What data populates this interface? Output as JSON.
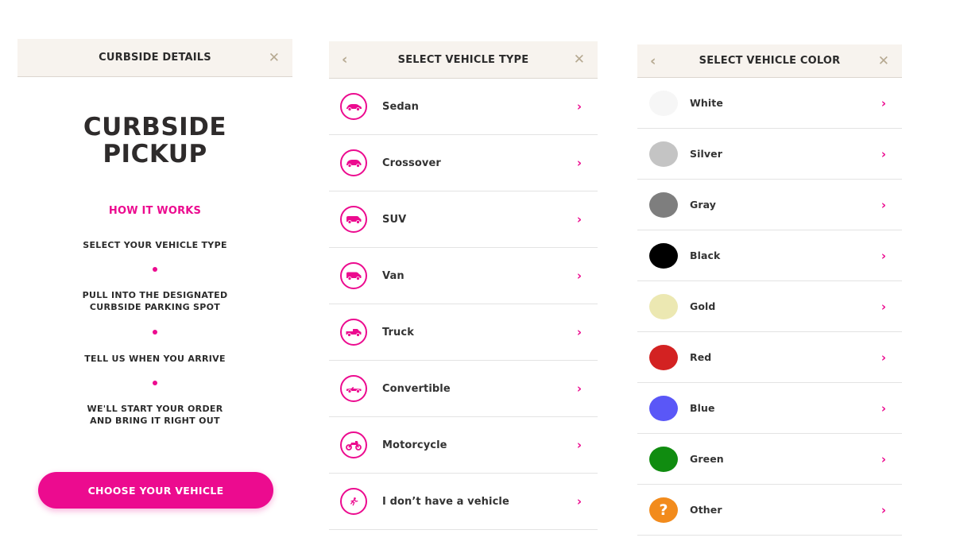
{
  "panel1": {
    "header_title": "CURBSIDE DETAILS",
    "close_symbol": "✕",
    "title_line1": "CURBSIDE",
    "title_line2": "PICKUP",
    "how_title": "HOW IT WORKS",
    "steps": [
      {
        "line1": "SELECT YOUR VEHICLE TYPE",
        "line2": ""
      },
      {
        "line1": "PULL INTO THE DESIGNATED",
        "line2": "CURBSIDE PARKING SPOT"
      },
      {
        "line1": "TELL US WHEN YOU ARRIVE",
        "line2": ""
      },
      {
        "line1": "WE'LL START YOUR ORDER",
        "line2": "AND BRING IT RIGHT OUT"
      }
    ],
    "cta_label": "CHOOSE YOUR VEHICLE"
  },
  "panel2": {
    "header_title": "SELECT VEHICLE TYPE",
    "back_symbol": "‹",
    "close_symbol": "✕",
    "items": [
      {
        "label": "Sedan",
        "icon": "sedan-icon"
      },
      {
        "label": "Crossover",
        "icon": "crossover-icon"
      },
      {
        "label": "SUV",
        "icon": "suv-icon"
      },
      {
        "label": "Van",
        "icon": "van-icon"
      },
      {
        "label": "Truck",
        "icon": "truck-icon"
      },
      {
        "label": "Convertible",
        "icon": "convertible-icon"
      },
      {
        "label": "Motorcycle",
        "icon": "motorcycle-icon"
      },
      {
        "label": "I don’t have a vehicle",
        "icon": "walking-person-icon"
      }
    ],
    "chevron": "›"
  },
  "panel3": {
    "header_title": "SELECT VEHICLE COLOR",
    "back_symbol": "‹",
    "close_symbol": "✕",
    "items": [
      {
        "label": "White",
        "color": "#f6f6f6"
      },
      {
        "label": "Silver",
        "color": "#c4c4c4"
      },
      {
        "label": "Gray",
        "color": "#7e7e7e"
      },
      {
        "label": "Black",
        "color": "#000000"
      },
      {
        "label": "Gold",
        "color": "#ece8b2"
      },
      {
        "label": "Red",
        "color": "#d32222"
      },
      {
        "label": "Blue",
        "color": "#5a57f7"
      },
      {
        "label": "Green",
        "color": "#108c10"
      },
      {
        "label": "Other",
        "color": "#f28b1c",
        "symbol": "?"
      }
    ],
    "chevron": "›"
  },
  "colors": {
    "accent": "#ec0b8f",
    "header_bg": "#f7f3ee",
    "header_icon": "#b6a991"
  }
}
